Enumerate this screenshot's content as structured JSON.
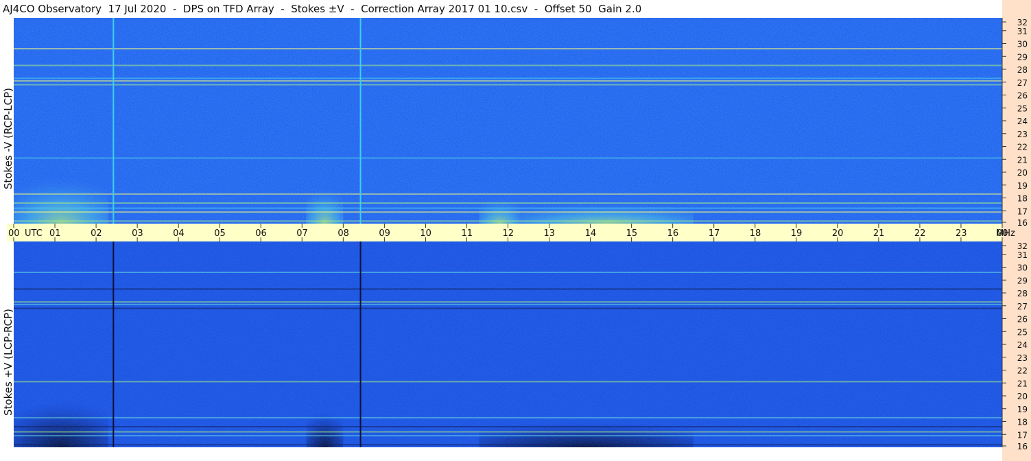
{
  "title": "AJ4CO Observatory  17 Jul 2020  -  DPS on TFD Array  -  Stokes ±V  -  Correction Array 2017 01 10.csv  -  Offset 50  Gain 2.0",
  "colors": {
    "background": "#ffffff",
    "right_strip": "#ffe0c8",
    "time_band": "#ffffc8",
    "axis_text": "#111111"
  },
  "chart_data": [
    {
      "type": "heatmap",
      "name": "Stokes -V (RCP-LCP)",
      "ylabel": "Stokes -V (RCP-LCP)",
      "xlabel": "UTC",
      "x_ticks": [
        "00",
        "01",
        "02",
        "03",
        "04",
        "05",
        "06",
        "07",
        "08",
        "09",
        "10",
        "11",
        "12",
        "13",
        "14",
        "15",
        "16",
        "17",
        "18",
        "19",
        "20",
        "21",
        "22",
        "23",
        "00"
      ],
      "x_range": [
        0,
        24
      ],
      "y_unit": "MHz",
      "y_ticks": [
        16,
        17,
        18,
        19,
        20,
        21,
        22,
        23,
        24,
        25,
        26,
        27,
        28,
        29,
        30,
        31,
        32
      ],
      "y_range": [
        16,
        32
      ],
      "colormap": [
        "#0a1f6e",
        "#1238c8",
        "#1e60f0",
        "#2a88f0",
        "#40c8e8",
        "#a0f080",
        "#ffff60",
        "#ff7040"
      ],
      "vertical_lines": [
        {
          "utc": 2.42,
          "color": "#40d0f0"
        },
        {
          "utc": 8.42,
          "color": "#40d0f0"
        }
      ],
      "bright_regions": [
        {
          "utc_start": 0.0,
          "utc_end": 2.3,
          "mhz_start": 16,
          "mhz_end": 20.5
        },
        {
          "utc_start": 7.1,
          "utc_end": 8.0,
          "mhz_start": 16,
          "mhz_end": 19.5
        },
        {
          "utc_start": 11.3,
          "utc_end": 12.3,
          "mhz_start": 16,
          "mhz_end": 18.5
        },
        {
          "utc_start": 12.3,
          "utc_end": 16.5,
          "mhz_start": 16,
          "mhz_end": 18.0
        }
      ],
      "rfi_bands_mhz": [
        16.2,
        16.9,
        17.2,
        17.6,
        18.3,
        21.1,
        26.8,
        27.1,
        27.3,
        28.3,
        29.6
      ]
    },
    {
      "type": "heatmap",
      "name": "Stokes +V (LCP-RCP)",
      "ylabel": "Stokes +V (LCP-RCP)",
      "xlabel": "UTC",
      "x_ticks": [
        "00",
        "01",
        "02",
        "03",
        "04",
        "05",
        "06",
        "07",
        "08",
        "09",
        "10",
        "11",
        "12",
        "13",
        "14",
        "15",
        "16",
        "17",
        "18",
        "19",
        "20",
        "21",
        "22",
        "23",
        "00"
      ],
      "x_range": [
        0,
        24
      ],
      "y_unit": "MHz",
      "y_ticks": [
        16,
        17,
        18,
        19,
        20,
        21,
        22,
        23,
        24,
        25,
        26,
        27,
        28,
        29,
        30,
        31,
        32
      ],
      "y_range": [
        16,
        32
      ],
      "colormap": [
        "#040c30",
        "#0a1f6e",
        "#1238c8",
        "#1e60f0",
        "#2a88f0",
        "#40c8e8",
        "#a0f080",
        "#ffff60"
      ],
      "vertical_lines": [
        {
          "utc": 2.42,
          "color": "#06103a"
        },
        {
          "utc": 8.42,
          "color": "#06103a"
        }
      ],
      "dark_regions": [
        {
          "utc_start": 0.0,
          "utc_end": 2.3,
          "mhz_start": 16,
          "mhz_end": 20.5
        },
        {
          "utc_start": 7.1,
          "utc_end": 8.0,
          "mhz_start": 16,
          "mhz_end": 19.5
        },
        {
          "utc_start": 11.3,
          "utc_end": 16.5,
          "mhz_start": 16,
          "mhz_end": 18.5
        }
      ],
      "rfi_bands_mhz": [
        16.2,
        16.9,
        17.2,
        17.6,
        18.3,
        21.1,
        26.8,
        27.1,
        27.3,
        28.3,
        29.6
      ]
    }
  ],
  "time_axis": {
    "labels": [
      "00",
      "01",
      "02",
      "03",
      "04",
      "05",
      "06",
      "07",
      "08",
      "09",
      "10",
      "11",
      "12",
      "13",
      "14",
      "15",
      "16",
      "17",
      "18",
      "19",
      "20",
      "21",
      "22",
      "23",
      "00"
    ],
    "utc_label": "UTC",
    "mhz_label": "MHz"
  }
}
